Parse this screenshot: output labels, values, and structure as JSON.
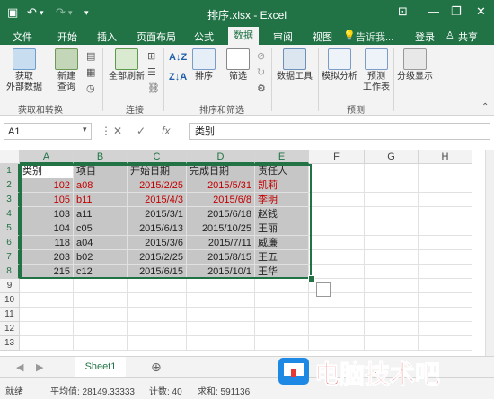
{
  "app": {
    "title": "排序.xlsx - Excel",
    "accent": "#217346",
    "quick_access": {
      "save_icon": "save-icon",
      "undo_icon": "undo-icon",
      "redo_icon": "redo-icon"
    },
    "window_controls": [
      "minimize-icon",
      "restore-icon",
      "close-icon"
    ]
  },
  "ribbon": {
    "tabs": [
      "文件",
      "开始",
      "插入",
      "页面布局",
      "公式",
      "数据",
      "审阅",
      "视图"
    ],
    "active_tab": "数据",
    "tell_me": "告诉我...",
    "login": "登录",
    "share": "共享",
    "groups": [
      {
        "label": "获取和转换",
        "buttons": [
          "获取\n外部数据",
          "新建\n查询"
        ]
      },
      {
        "label": "连接",
        "buttons": [
          "全部刷新"
        ]
      },
      {
        "label": "排序和筛选",
        "buttons": [
          "排序",
          "筛选"
        ]
      },
      {
        "label": "",
        "buttons": [
          "数据工具"
        ]
      },
      {
        "label": "预测",
        "buttons": [
          "模拟分析",
          "预测\n工作表"
        ]
      },
      {
        "label": "",
        "buttons": [
          "分级显示"
        ]
      }
    ]
  },
  "formula_bar": {
    "name_box": "A1",
    "fx": "fx",
    "value": "类别"
  },
  "sheet": {
    "columns": [
      "A",
      "B",
      "C",
      "D",
      "E",
      "F",
      "G",
      "H"
    ],
    "selected_columns": [
      "A",
      "B",
      "C",
      "D",
      "E"
    ],
    "rows": [
      [
        "类别",
        "项目",
        "开始日期",
        "完成日期",
        "责任人"
      ],
      [
        "102",
        "a08",
        "2015/2/25",
        "2015/5/31",
        "凯莉"
      ],
      [
        "105",
        "b11",
        "2015/4/3",
        "2015/6/8",
        "李明"
      ],
      [
        "103",
        "a11",
        "2015/3/1",
        "2015/6/18",
        "赵钱"
      ],
      [
        "104",
        "c05",
        "2015/6/13",
        "2015/10/25",
        "王丽"
      ],
      [
        "118",
        "a04",
        "2015/3/6",
        "2015/7/11",
        "威廉"
      ],
      [
        "203",
        "b02",
        "2015/2/25",
        "2015/8/15",
        "王五"
      ],
      [
        "215",
        "c12",
        "2015/6/15",
        "2015/10/1",
        "王华"
      ]
    ],
    "red_rows": [
      1,
      2
    ],
    "row_numbers": [
      "1",
      "2",
      "3",
      "4",
      "5",
      "6",
      "7",
      "8",
      "9",
      "10",
      "11",
      "12",
      "13"
    ]
  },
  "sheet_tabs": {
    "active": "Sheet1",
    "add_icon": "add-sheet-icon"
  },
  "status_bar": {
    "ready": "就绪",
    "average": "平均值: 28149.33333",
    "count": "计数: 40",
    "sum": "求和: 591136"
  },
  "watermark": {
    "text": "电脑技术吧"
  }
}
